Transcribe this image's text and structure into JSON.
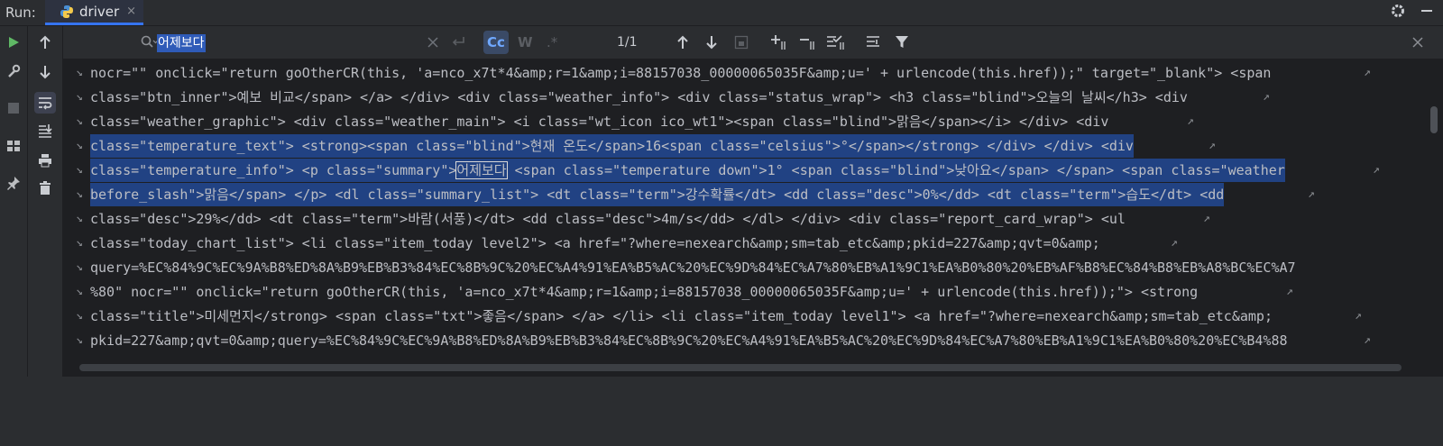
{
  "runbar": {
    "run_label": "Run:",
    "tab_title": "driver",
    "tab_close": "×"
  },
  "search": {
    "query": "어제보다",
    "match_count": "1/1",
    "case_label": "Cc",
    "words_label": "W",
    "regex_label": ".*"
  },
  "editor": {
    "lines": [
      "nocr=\"\" onclick=\"return goOtherCR(this, 'a=nco_x7t*4&amp;r=1&amp;i=88157038_00000065035F&amp;u=' + urlencode(this.href));\" target=\"_blank\"> <span",
      "class=\"btn_inner\">예보 비교</span> </a> </div> <div class=\"weather_info\"> <div class=\"status_wrap\"> <h3 class=\"blind\">오늘의 날씨</h3> <div",
      "class=\"weather_graphic\"> <div class=\"weather_main\"> <i class=\"wt_icon ico_wt1\"><span class=\"blind\">맑음</span></i> </div> <div",
      "class=\"temperature_text\"> <strong><span class=\"blind\">현재 온도</span>16<span class=\"celsius\">°</span></strong> </div> </div> <div",
      "before_slash\">맑음</span> </p> <dl class=\"summary_list\"> <dt class=\"term\">강수확률</dt> <dd class=\"desc\">0%</dd> <dt class=\"term\">습도</dt> <dd",
      "class=\"desc\">29%</dd> <dt class=\"term\">바람(서풍)</dt> <dd class=\"desc\">4m/s</dd> </dl> </div> <div class=\"report_card_wrap\"> <ul",
      "class=\"today_chart_list\"> <li class=\"item_today level2\"> <a href=\"?where=nexearch&amp;sm=tab_etc&amp;pkid=227&amp;qvt=0&amp;",
      "query=%EC%84%9C%EC%9A%B8%ED%8A%B9%EB%B3%84%EC%8B%9C%20%EC%A4%91%EA%B5%AC%20%EC%9D%84%EC%A7%80%EB%A1%9C1%EA%B0%80%20%EB%AF%B8%EC%84%B8%EB%A8%BC%EC%A7",
      "%80\" nocr=\"\" onclick=\"return goOtherCR(this, 'a=nco_x7t*4&amp;r=1&amp;i=88157038_00000065035F&amp;u=' + urlencode(this.href));\"> <strong",
      "class=\"title\">미세먼지</strong> <span class=\"txt\">좋음</span> </a> </li> <li class=\"item_today level1\"> <a href=\"?where=nexearch&amp;sm=tab_etc&amp;",
      "pkid=227&amp;qvt=0&amp;query=%EC%84%9C%EC%9A%B8%ED%8A%B9%EB%B3%84%EC%8B%9C%20%EC%A4%91%EA%B5%AC%20%EC%9D%84%EC%A7%80%EB%A1%9C1%EA%B0%80%20%EC%B4%88"
    ],
    "line5_pre": "class=\"temperature_info\"> <p class=\"summary\">",
    "line5_match": "어제보다",
    "line5_post": " <span class=\"temperature down\">1° <span class=\"blind\">낮아요</span> </span> <span class=\"weather"
  },
  "colors": {
    "accent": "#3574f0",
    "selection": "#214283",
    "run_green": "#5fb865"
  }
}
